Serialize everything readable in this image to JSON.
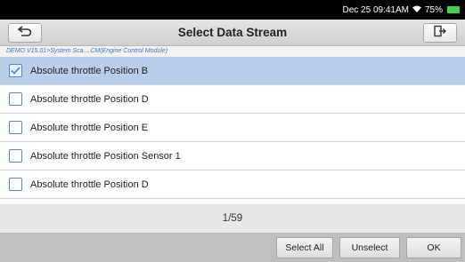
{
  "status_bar": {
    "datetime": "Dec 25 09:41AM",
    "battery": "75%",
    "icons": [
      "wifi-icon",
      "battery-icon"
    ],
    "battery_color": "#40d44a"
  },
  "header": {
    "title": "Select Data Stream",
    "back_icon": "back-arrow-icon",
    "exit_icon": "exit-icon"
  },
  "breadcrumb": "DEMO V15.01>System Sca....CM(Engine Control Module)",
  "items": [
    {
      "label": "Absolute throttle Position B",
      "checked": true
    },
    {
      "label": "Absolute throttle Position D",
      "checked": false
    },
    {
      "label": "Absolute throttle Position E",
      "checked": false
    },
    {
      "label": "Absolute throttle Position Sensor 1",
      "checked": false
    },
    {
      "label": "Absolute throttle Position D",
      "checked": false
    }
  ],
  "pagination": "1/59",
  "footer": {
    "select_all": "Select All",
    "unselect": "Unselect",
    "ok": "OK"
  },
  "colors": {
    "selected_row": "#b9cfe9",
    "checkbox_border": "#4a8ad8",
    "breadcrumb_text": "#3b78c8"
  }
}
